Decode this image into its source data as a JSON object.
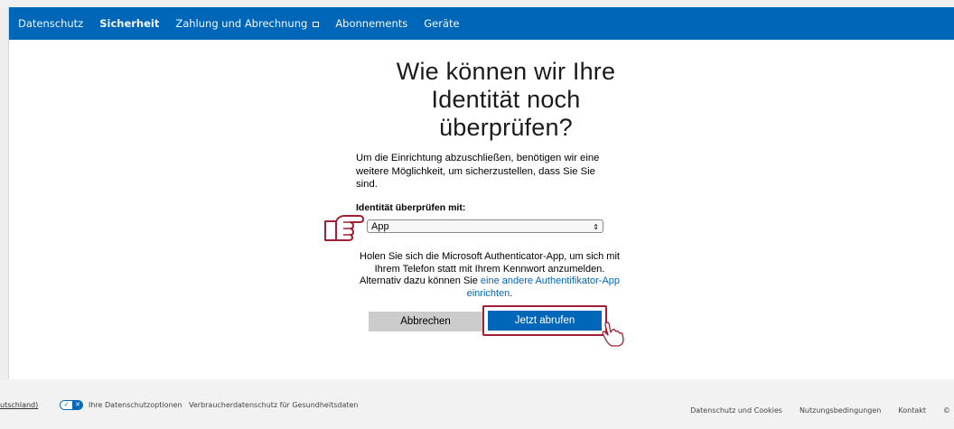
{
  "nav": {
    "items": [
      {
        "label": "Datenschutz",
        "active": false
      },
      {
        "label": "Sicherheit",
        "active": true
      },
      {
        "label": "Zahlung und Abrechnung",
        "active": false
      },
      {
        "label": "Abonnements",
        "active": false
      },
      {
        "label": "Geräte",
        "active": false
      }
    ]
  },
  "main": {
    "title_lines": [
      "Wie können wir Ihre",
      "Identität noch",
      "überprüfen?"
    ],
    "intro": "Um die Einrichtung abzuschließen, benötigen wir eine weitere Möglichkeit, um sicherzustellen, dass Sie Sie sind.",
    "verify_label": "Identität überprüfen mit:",
    "select_value": "App",
    "info_text": "Holen Sie sich die Microsoft Authenticator-App, um sich mit Ihrem Telefon statt mit Ihrem Kennwort anzumelden. Alternativ dazu können Sie ",
    "info_link": "eine andere Authentifikator-App einrichten",
    "info_end": ".",
    "cancel_label": "Abbrechen",
    "primary_label": "Jetzt abrufen"
  },
  "footer": {
    "region": "utschland)",
    "privacy_options": "Ihre Datenschutzoptionen",
    "consumer_health": "Verbraucherdatenschutz für Gesundheitsdaten",
    "links": [
      "Datenschutz und Cookies",
      "Nutzungsbedingungen",
      "Kontakt",
      "©"
    ]
  },
  "colors": {
    "accent": "#0067b8",
    "highlight": "#a11f34"
  }
}
